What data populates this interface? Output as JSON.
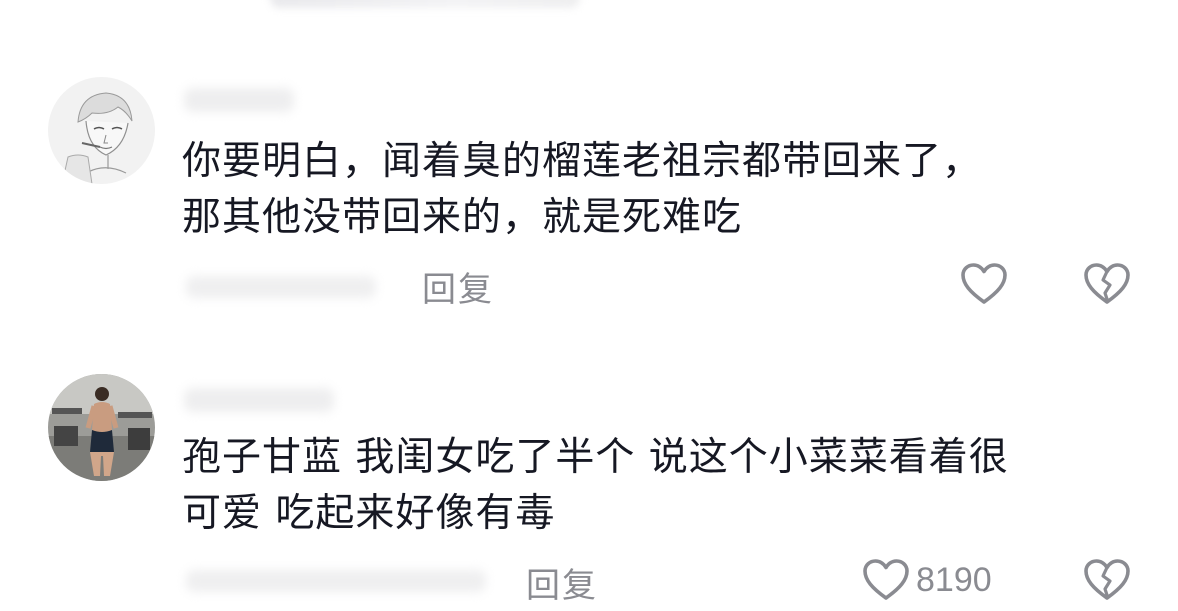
{
  "colors": {
    "text_primary": "#161823",
    "text_secondary": "#8a8b91",
    "icon": "#8a8b91"
  },
  "comments": [
    {
      "avatar": "sketch-portrait-avatar",
      "text_lines": [
        "你要明白，闻着臭的榴莲老祖宗都带回来了，",
        "那其他没带回来的，就是死难吃"
      ],
      "reply_label": "回复",
      "like_count": "",
      "like_icon": "heart-outline-icon",
      "dislike_icon": "broken-heart-icon"
    },
    {
      "avatar": "gym-photo-avatar",
      "text_lines": [
        "孢子甘蓝 我闺女吃了半个 说这个小菜菜看着很",
        "可爱  吃起来好像有毒"
      ],
      "reply_label": "回复",
      "like_count": "8190",
      "like_icon": "heart-outline-icon",
      "dislike_icon": "broken-heart-icon"
    }
  ]
}
